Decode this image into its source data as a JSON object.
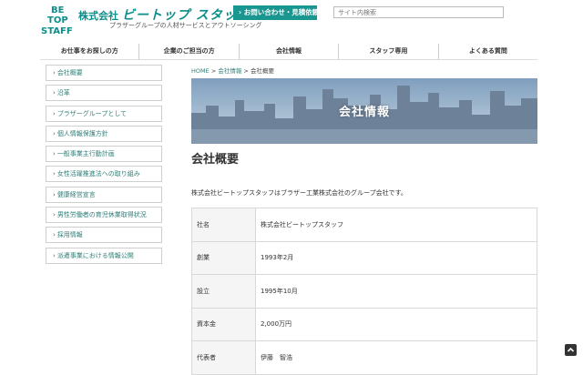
{
  "header": {
    "logo_lines": [
      "BE",
      "TOP",
      "STAFF"
    ],
    "brand_prefix": "株式会社",
    "brand_name": "ビートップ スタッフ",
    "tagline": "プラザーグループの人材サービスとアウトソーシング",
    "contact_label": "お問い合わせ・見積依頼",
    "search_placeholder": "サイト内検索",
    "brand_color": "#0c8e8a"
  },
  "gnav": {
    "items": [
      "お仕事をお探しの方",
      "企業のご担当の方",
      "会社情報",
      "スタッフ専用",
      "よくある質問"
    ]
  },
  "sidebar": {
    "items": [
      "会社概要",
      "沿革",
      "ブラザーグループとして",
      "個人情報保護方針",
      "一般事業主行動計画",
      "女性活躍推進法への取り組み",
      "健康経営宣言",
      "男性労働者の育児休業取得状況",
      "採用情報",
      "派遣事業における情報公開"
    ]
  },
  "breadcrumb": {
    "home": "HOME",
    "sep": ">",
    "parent": "会社情報",
    "current": "会社概要"
  },
  "banner": {
    "title": "会社情報"
  },
  "main": {
    "title": "会社概要",
    "intro": "株式会社ビートップスタッフはブラザー工業株式会社のグループ会社です。",
    "rows": [
      {
        "label": "社名",
        "value": "株式会社ビートップスタッフ"
      },
      {
        "label": "創業",
        "value": "1993年2月"
      },
      {
        "label": "設立",
        "value": "1995年10月"
      },
      {
        "label": "資本金",
        "value": "2,000万円"
      },
      {
        "label": "代表者",
        "value": "伊藤　智浩"
      }
    ]
  },
  "icons": {
    "sidebar_chevron": "chevron-right-icon",
    "contact_chevron": "chevron-right-icon",
    "page_top": "chevron-up-icon"
  }
}
